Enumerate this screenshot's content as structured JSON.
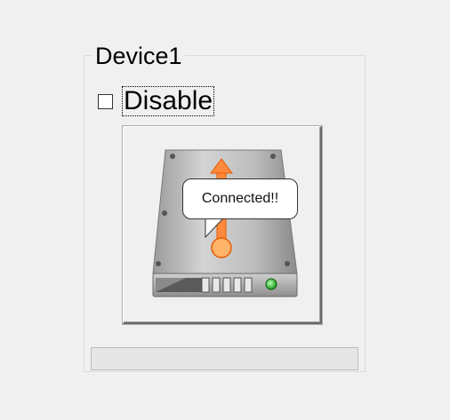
{
  "groupbox": {
    "title": "Device1"
  },
  "disable_checkbox": {
    "label": "Disable",
    "checked": false
  },
  "device_button": {
    "icon": "hard-drive-icon",
    "status_icon": "connection-arrow-icon",
    "tooltip": "Connected!!"
  },
  "progress": {
    "value": 0
  },
  "colors": {
    "background": "#f0f0f0",
    "arrow": "#ff8a3d",
    "led": "#22bb22"
  }
}
